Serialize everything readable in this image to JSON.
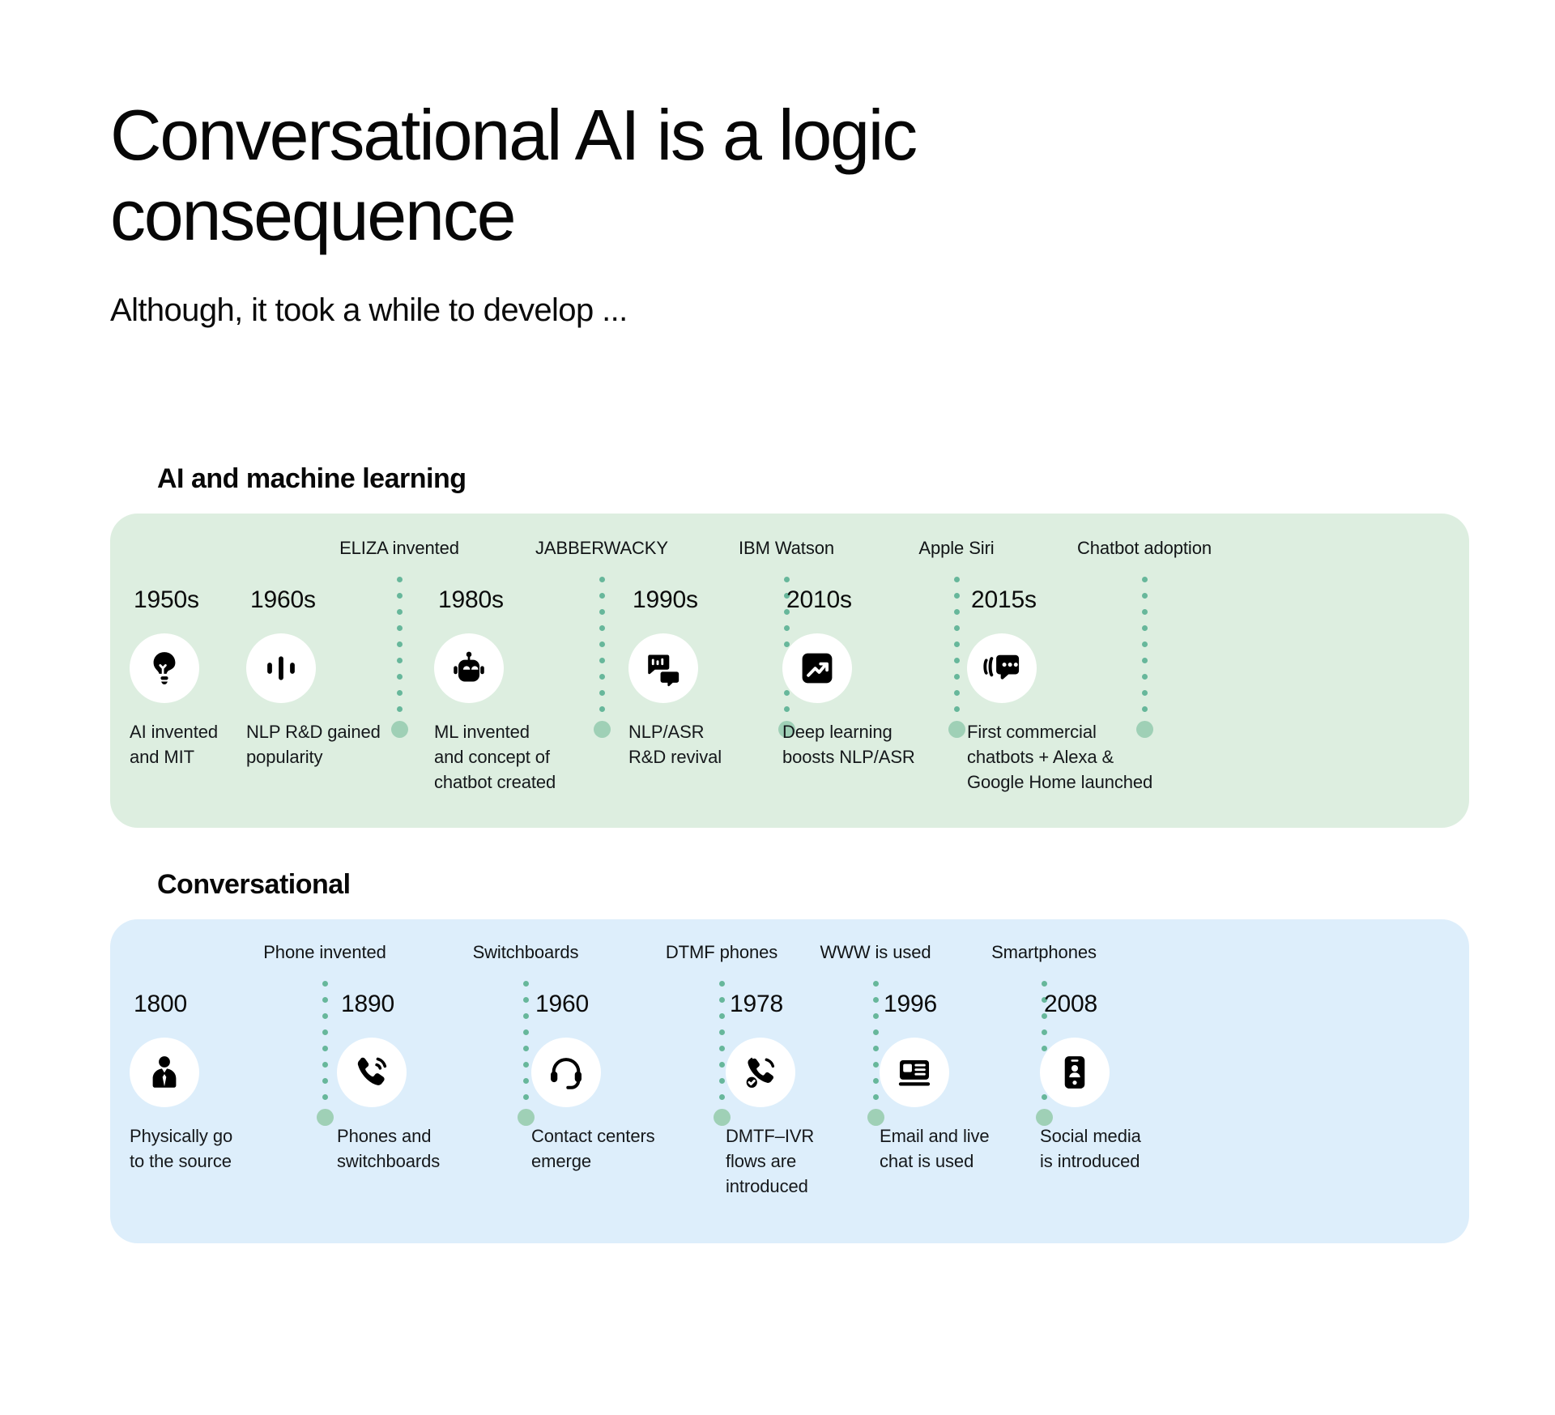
{
  "header": {
    "title": "Conversational AI is a logic\nconsequence",
    "subtitle": "Although, it took a while to develop ..."
  },
  "colors": {
    "green_panel": "#ddeee0",
    "blue_panel": "#ddeefb",
    "dot": "#67b79b",
    "blob": "#9fd0b6",
    "icon_circle": "#ffffff",
    "text": "#111111"
  },
  "sections": [
    {
      "id": "ai-and-machine-learning",
      "heading": "AI and machine learning",
      "panel_color": "#ddeee0",
      "events": [
        {
          "year": "1950s",
          "desc": "AI invented\nand MIT",
          "icon": "lightbulb-icon"
        },
        {
          "year": "1960s",
          "desc": "NLP R&D gained\npopularity",
          "icon": "voice-waveform-icon"
        },
        {
          "year": "1980s",
          "desc": "ML invented\nand concept of\nchatbot created",
          "icon": "robot-icon"
        },
        {
          "year": "1990s",
          "desc": "NLP/ASR\nR&D revival",
          "icon": "chat-bubbles-icon"
        },
        {
          "year": "2010s",
          "desc": "Deep learning\nboosts NLP/ASR",
          "icon": "trending-up-icon"
        },
        {
          "year": "2015s",
          "desc": "First commercial\nchatbots + Alexa &\nGoogle Home launched",
          "icon": "chat-dots-icon"
        }
      ],
      "markers": [
        {
          "label": "ELIZA invented"
        },
        {
          "label": "JABBERWACKY"
        },
        {
          "label": "IBM Watson"
        },
        {
          "label": "Apple Siri"
        },
        {
          "label": "Chatbot adoption"
        }
      ]
    },
    {
      "id": "conversational",
      "heading": "Conversational",
      "panel_color": "#ddeefb",
      "events": [
        {
          "year": "1800",
          "desc": "Physically go\nto the source",
          "icon": "person-suit-icon"
        },
        {
          "year": "1890",
          "desc": "Phones and\nswitchboards",
          "icon": "phone-ringing-icon"
        },
        {
          "year": "1960",
          "desc": "Contact centers\nemerge",
          "icon": "headset-icon"
        },
        {
          "year": "1978",
          "desc": "DMTF–IVR\nflows are\nintroduced",
          "icon": "phone-check-icon"
        },
        {
          "year": "1996",
          "desc": "Email and live\nchat is used",
          "icon": "email-card-icon"
        },
        {
          "year": "2008",
          "desc": "Social media\nis introduced",
          "icon": "smartphone-person-icon"
        }
      ],
      "markers": [
        {
          "label": "Phone invented"
        },
        {
          "label": "Switchboards"
        },
        {
          "label": "DTMF phones"
        },
        {
          "label": "WWW is used"
        },
        {
          "label": "Smartphones"
        }
      ]
    }
  ]
}
